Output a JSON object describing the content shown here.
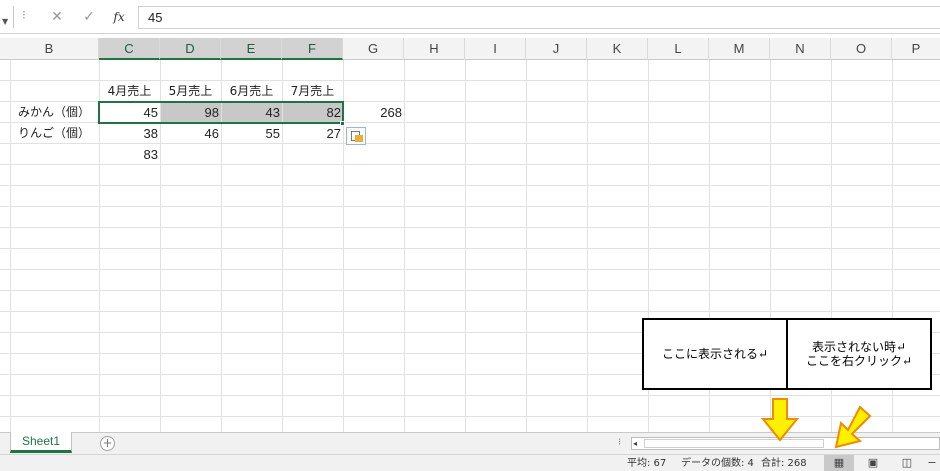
{
  "formula_bar": {
    "cancel_glyph": "✕",
    "enter_glyph": "✓",
    "fx_label": "fx",
    "value": "45"
  },
  "columns": [
    "B",
    "C",
    "D",
    "E",
    "F",
    "G",
    "H",
    "I",
    "J",
    "K",
    "L",
    "M",
    "N",
    "O",
    "P"
  ],
  "selected_columns": [
    "C",
    "D",
    "E",
    "F"
  ],
  "table": {
    "headers": [
      "4月売上",
      "5月売上",
      "6月売上",
      "7月売上"
    ],
    "rows": [
      {
        "label": "みかん（個）",
        "values": [
          "45",
          "98",
          "43",
          "82"
        ]
      },
      {
        "label": "りんご（個）",
        "values": [
          "38",
          "46",
          "55",
          "27"
        ]
      }
    ],
    "sum_row_g": "268",
    "sum_col_c": "83"
  },
  "notes": {
    "left": "ここに表示される↵",
    "right_line1": "表示されない時↵",
    "right_line2": "ここを右クリック↵"
  },
  "sheet": {
    "tab_label": "Sheet1",
    "add_glyph": "+"
  },
  "status": {
    "average": "平均: 67",
    "count": "データの個数: 4",
    "sum": "合計: 268"
  },
  "colors": {
    "accent": "#217346",
    "selection_fill": "#c8c8c8",
    "arrow_fill": "#ffef00",
    "arrow_stroke": "#f08a00"
  }
}
